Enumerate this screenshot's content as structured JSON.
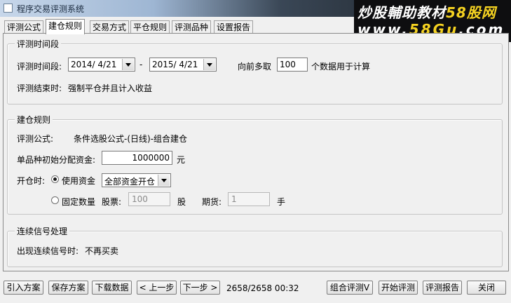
{
  "window": {
    "title": "程序交易评测系统"
  },
  "watermark": {
    "line1_a": "炒股輔助教材",
    "line1_b": "58股网",
    "line2_a": "www.",
    "line2_b": "58Gu",
    "line2_c": ".com"
  },
  "tabs": [
    {
      "label": "评测公式"
    },
    {
      "label": "建仓规则"
    },
    {
      "label": "交易方式"
    },
    {
      "label": "平仓规则"
    },
    {
      "label": "评测品种"
    },
    {
      "label": "设置报告"
    }
  ],
  "period": {
    "group_title": "评测时间段",
    "label": "评测时间段:",
    "start_date": "2014/ 4/21",
    "dash": "-",
    "end_date": "2015/ 4/21",
    "lookback_label": "向前多取",
    "lookback_value": "100",
    "lookback_suffix": "个数据用于计算",
    "end_label": "评测结束时:",
    "end_value": "强制平仓并且计入收益"
  },
  "rules": {
    "group_title": "建仓规则",
    "formula_label": "评测公式:",
    "formula_value": "条件选股公式-(日线)-组合建仓",
    "capital_label": "单品种初始分配资金:",
    "capital_value": "1000000",
    "capital_unit": "元",
    "open_label": "开仓时:",
    "use_funds_label": "使用资金",
    "use_funds_option": "全部资金开仓",
    "fixed_qty_label": "固定数量",
    "stock_label": "股票:",
    "stock_value": "100",
    "stock_unit": "股",
    "futures_label": "期货:",
    "futures_value": "1",
    "futures_unit": "手"
  },
  "signal": {
    "group_title": "连续信号处理",
    "label": "出现连续信号时:",
    "value": "不再买卖"
  },
  "footer": {
    "import": "引入方案",
    "save": "保存方案",
    "download": "下载数据",
    "prev": "< 上一步",
    "next": "下一步 >",
    "status": "2658/2658 00:32",
    "combo_eval": "组合评测V",
    "start_eval": "开始评测",
    "report": "评测报告",
    "close": "关闭"
  }
}
